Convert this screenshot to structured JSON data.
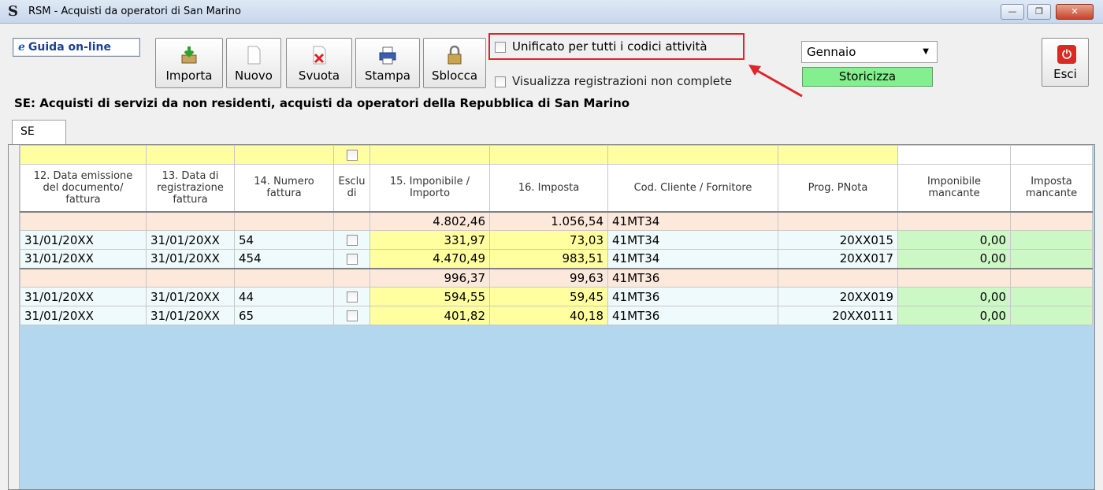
{
  "window": {
    "title": "RSM - Acquisti da operatori di San Marino",
    "app_icon": "S",
    "buttons": [
      "minimize-icon",
      "restore-icon",
      "close-icon"
    ]
  },
  "toolbar": {
    "help_label": "Guida on-line",
    "buttons": [
      {
        "label": "Importa",
        "icon": "import-icon"
      },
      {
        "label": "Nuovo",
        "icon": "new-document-icon"
      },
      {
        "label": "Svuota",
        "icon": "clear-icon"
      },
      {
        "label": "Stampa",
        "icon": "printer-icon"
      },
      {
        "label": "Sblocca",
        "icon": "padlock-icon"
      }
    ],
    "unificato_label": "Unificato per tutti i codici attività",
    "visualizza_label": "Visualizza registrazioni non complete",
    "month": "Gennaio",
    "storicizza_label": "Storicizza",
    "esci_label": "Esci"
  },
  "section_title": "SE: Acquisti di servizi da non residenti, acquisti da operatori della Repubblica di San Marino",
  "tab_label": "SE",
  "table": {
    "headers": [
      "12. Data emissione del documento/ fattura",
      "13. Data di registrazione fattura",
      "14. Numero fattura",
      "Esclu di",
      "15. Imponibile / Importo",
      "16. Imposta",
      "Cod. Cliente / Fornitore",
      "Prog. PNota",
      "Imponibile mancante",
      "Imposta mancante"
    ],
    "groups": [
      {
        "imponibile": "4.802,46",
        "imposta": "1.056,54",
        "codice": "41MT34",
        "rows": [
          {
            "data_em": "31/01/20XX",
            "data_reg": "31/01/20XX",
            "numero": "54",
            "imponibile": "331,97",
            "imposta": "73,03",
            "codice": "41MT34",
            "pnota": "20XX015",
            "imp_manc": "0,00"
          },
          {
            "data_em": "31/01/20XX",
            "data_reg": "31/01/20XX",
            "numero": "454",
            "imponibile": "4.470,49",
            "imposta": "983,51",
            "codice": "41MT34",
            "pnota": "20XX017",
            "imp_manc": "0,00"
          }
        ]
      },
      {
        "imponibile": "996,37",
        "imposta": "99,63",
        "codice": "41MT36",
        "rows": [
          {
            "data_em": "31/01/20XX",
            "data_reg": "31/01/20XX",
            "numero": "44",
            "imponibile": "594,55",
            "imposta": "59,45",
            "codice": "41MT36",
            "pnota": "20XX019",
            "imp_manc": "0,00"
          },
          {
            "data_em": "31/01/20XX",
            "data_reg": "31/01/20XX",
            "numero": "65",
            "imponibile": "401,82",
            "imposta": "40,18",
            "codice": "41MT36",
            "pnota": "20XX0111",
            "imp_manc": "0,00"
          }
        ]
      }
    ]
  },
  "colors": {
    "filter_yellow": "#ffff9f",
    "group_row": "#fde8dc",
    "data_row": "#eefafb",
    "missing_green": "#ccf8c6",
    "grid_background": "#b2d7ee",
    "highlight_red": "#e0242a",
    "storicizza_green": "#84ef8e"
  }
}
